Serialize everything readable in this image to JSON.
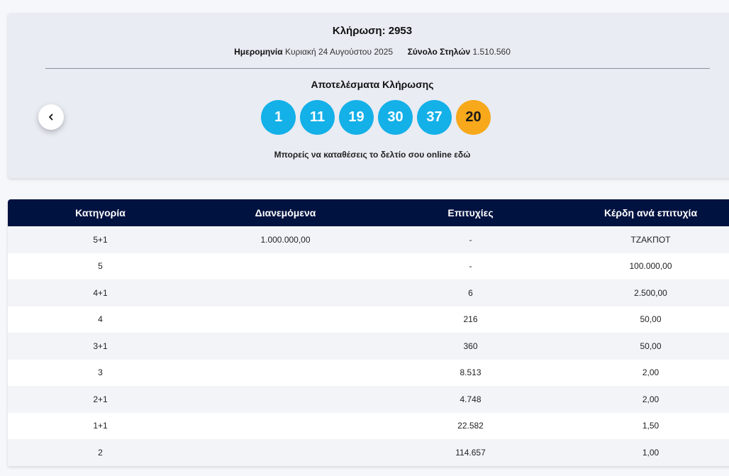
{
  "draw": {
    "title": "Κλήρωση: 2953",
    "date_label": "Ημερομηνία",
    "date_value": "Κυριακή 24 Αυγούστου 2025",
    "columns_label": "Σύνολο Στηλών",
    "columns_value": "1.510.560",
    "results_title": "Αποτελέσματα Κλήρωσης",
    "numbers": [
      "1",
      "11",
      "19",
      "30",
      "37"
    ],
    "bonus_number": "20",
    "online_text": "Μπορείς να καταθέσεις το δελτίο σου online εδώ",
    "prev_icon": "chevron-left-icon"
  },
  "colors": {
    "ball_main": "#14b0e8",
    "ball_bonus": "#f7a81b",
    "table_header": "#001240"
  },
  "table": {
    "headers": [
      "Κατηγορία",
      "Διανεμόμενα",
      "Επιτυχίες",
      "Κέρδη ανά επιτυχία"
    ],
    "rows": [
      {
        "category": "5+1",
        "distributed": "1.000.000,00",
        "winners": "-",
        "prize": "ΤΖΑΚΠΟΤ"
      },
      {
        "category": "5",
        "distributed": "",
        "winners": "-",
        "prize": "100.000,00"
      },
      {
        "category": "4+1",
        "distributed": "",
        "winners": "6",
        "prize": "2.500,00"
      },
      {
        "category": "4",
        "distributed": "",
        "winners": "216",
        "prize": "50,00"
      },
      {
        "category": "3+1",
        "distributed": "",
        "winners": "360",
        "prize": "50,00"
      },
      {
        "category": "3",
        "distributed": "",
        "winners": "8.513",
        "prize": "2,00"
      },
      {
        "category": "2+1",
        "distributed": "",
        "winners": "4.748",
        "prize": "2,00"
      },
      {
        "category": "1+1",
        "distributed": "",
        "winners": "22.582",
        "prize": "1,50"
      },
      {
        "category": "2",
        "distributed": "",
        "winners": "114.657",
        "prize": "1,00"
      }
    ]
  }
}
